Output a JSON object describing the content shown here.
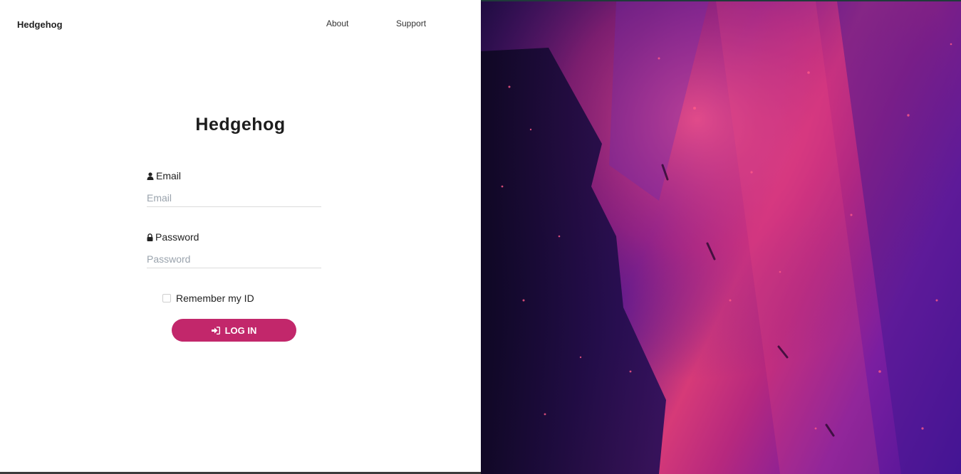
{
  "navbar": {
    "brand": "Hedgehog",
    "links": [
      {
        "label": "About"
      },
      {
        "label": "Support"
      }
    ]
  },
  "login_form": {
    "title": "Hedgehog",
    "email": {
      "label": "Email",
      "placeholder": "Email",
      "icon": "user-icon"
    },
    "password": {
      "label": "Password",
      "placeholder": "Password",
      "icon": "lock-icon"
    },
    "remember": {
      "label": "Remember my ID",
      "checked": false
    },
    "submit": {
      "label": "LOG IN",
      "icon": "sign-in-icon"
    }
  },
  "colors": {
    "accent": "#c2276b",
    "background_image_dominant": [
      "#2a0f5a",
      "#d63a78",
      "#7a1ea0"
    ]
  }
}
